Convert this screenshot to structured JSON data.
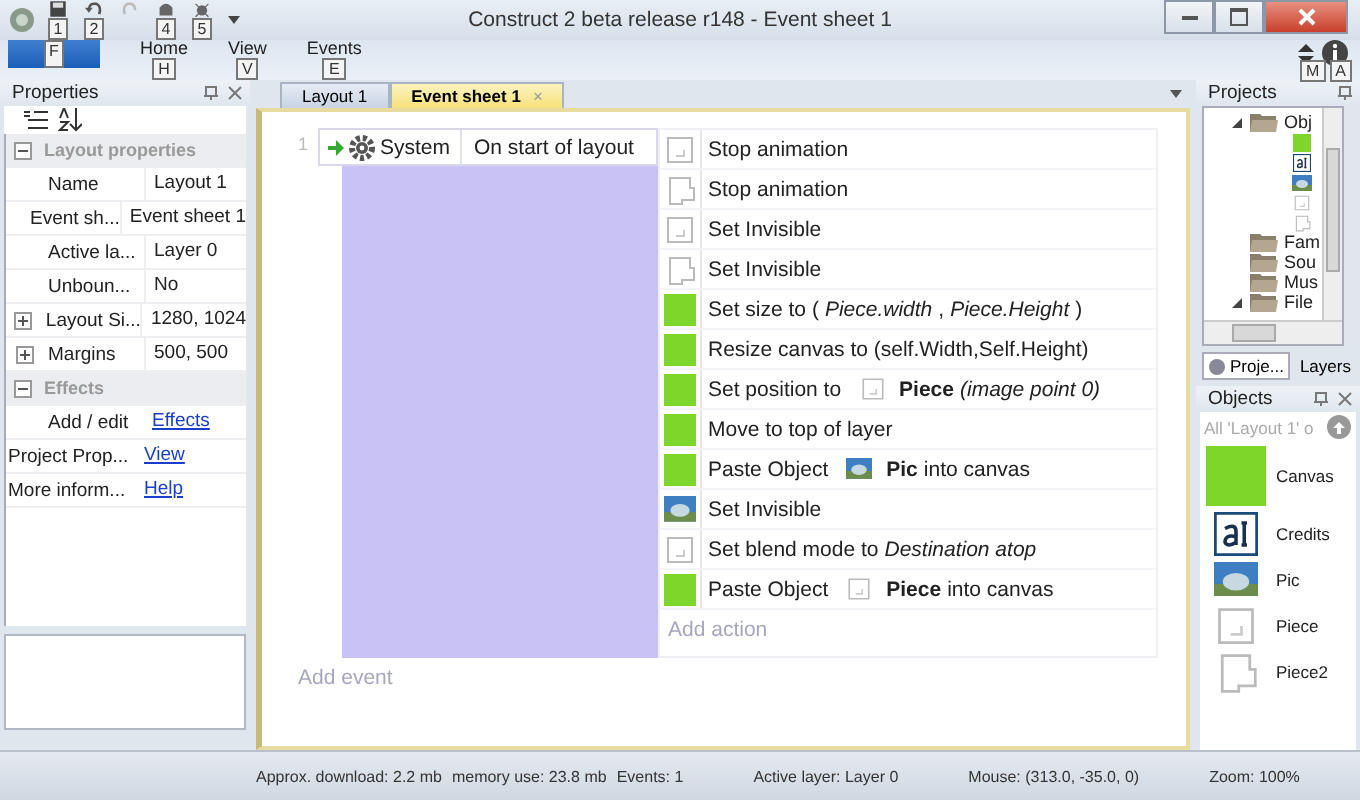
{
  "window": {
    "title": "Construct 2 beta release r148 - Event sheet 1"
  },
  "quick_access": [
    {
      "kind": "save",
      "keytip": "1"
    },
    {
      "kind": "undo",
      "keytip": "2"
    },
    {
      "kind": "redo"
    },
    {
      "kind": "preview",
      "keytip": "4"
    },
    {
      "kind": "debug",
      "keytip": "5"
    }
  ],
  "ribbon_tabs": [
    {
      "keytip": "F",
      "kind": "file"
    },
    {
      "label": "Home",
      "keytip": "H",
      "kind": "tab"
    },
    {
      "label": "View",
      "keytip": "V",
      "kind": "tab"
    },
    {
      "label": "Events",
      "keytip": "E",
      "kind": "tab"
    }
  ],
  "ribbon_right_keytips": [
    "M",
    "A"
  ],
  "properties": {
    "title": "Properties",
    "groups": [
      {
        "label": "Layout properties",
        "expanded": true,
        "rows": [
          {
            "name": "Name",
            "value": "Layout 1"
          },
          {
            "name": "Event sh...",
            "value": "Event sheet 1"
          },
          {
            "name": "Active la...",
            "value": "Layer 0"
          },
          {
            "name": "Unboun...",
            "value": "No"
          },
          {
            "name": "Layout Si...",
            "value": "1280, 1024",
            "expandable": true
          },
          {
            "name": "Margins",
            "value": "500, 500",
            "expandable": true
          }
        ]
      },
      {
        "label": "Effects",
        "expanded": true,
        "rows": [
          {
            "name": "Add / edit",
            "value": "Effects",
            "link": true
          }
        ]
      }
    ],
    "footer_rows": [
      {
        "name": "Project Prop...",
        "value": "View",
        "link": true
      },
      {
        "name": "More inform...",
        "value": "Help",
        "link": true
      }
    ]
  },
  "doc_tabs": [
    {
      "label": "Layout 1",
      "selected": false
    },
    {
      "label": "Event sheet 1",
      "selected": true,
      "close": "×"
    }
  ],
  "event": {
    "number": "1",
    "object": "System",
    "condition": "On start of layout",
    "actions": [
      {
        "kind": "piece",
        "text": "Stop animation"
      },
      {
        "kind": "piece2",
        "text": "Stop animation"
      },
      {
        "kind": "piece",
        "text": "Set Invisible"
      },
      {
        "kind": "piece2",
        "text": "Set Invisible"
      },
      {
        "kind": "canvas",
        "text": "Set size to (*Piece.width*, *Piece.Height*)"
      },
      {
        "kind": "canvas",
        "text": "Resize canvas to (self.Width,Self.Height)"
      },
      {
        "kind": "canvas",
        "text": "Set position to",
        "param": {
          "kind": "piece",
          "text": "**Piece** *(image point 0)*"
        }
      },
      {
        "kind": "canvas",
        "text": "Move to top of layer"
      },
      {
        "kind": "canvas",
        "text": "Paste Object",
        "param": {
          "kind": "pic",
          "text": "**Pic** into canvas"
        }
      },
      {
        "kind": "pic",
        "text": "Set Invisible"
      },
      {
        "kind": "piece",
        "text": "Set blend mode to *Destination atop*"
      },
      {
        "kind": "canvas",
        "text": "Paste Object",
        "param": {
          "kind": "piece",
          "text": "**Piece** into canvas"
        }
      }
    ],
    "add_action": "Add action"
  },
  "add_event": "Add event",
  "projects": {
    "title": "Projects",
    "tree": [
      {
        "label": "Obj",
        "kind": "folder",
        "expanded": true,
        "children": [
          {
            "kind": "canvas"
          },
          {
            "kind": "text"
          },
          {
            "kind": "pic"
          },
          {
            "kind": "piece"
          },
          {
            "kind": "piece2"
          }
        ]
      },
      {
        "label": "Fam",
        "kind": "folder"
      },
      {
        "label": "Sou",
        "kind": "folder"
      },
      {
        "label": "Mus",
        "kind": "folder"
      },
      {
        "label": "File",
        "kind": "folder",
        "expanded": true
      }
    ],
    "tabs": [
      {
        "label": "Proje...",
        "selected": true
      },
      {
        "label": "Layers",
        "selected": false
      }
    ]
  },
  "objects": {
    "title": "Objects",
    "filter": "All 'Layout 1' o",
    "items": [
      {
        "kind": "canvas",
        "label": "Canvas"
      },
      {
        "kind": "text",
        "label": "Credits"
      },
      {
        "kind": "pic",
        "label": "Pic"
      },
      {
        "kind": "piece",
        "label": "Piece"
      },
      {
        "kind": "piece2",
        "label": "Piece2"
      }
    ]
  },
  "status_bar": [
    "Approx. download: 2.2 mb",
    "memory use: 23.8 mb",
    "Events: 1",
    "Active layer: Layer 0",
    "Mouse: (313.0, -35.0, 0)",
    "Zoom: 100%"
  ]
}
